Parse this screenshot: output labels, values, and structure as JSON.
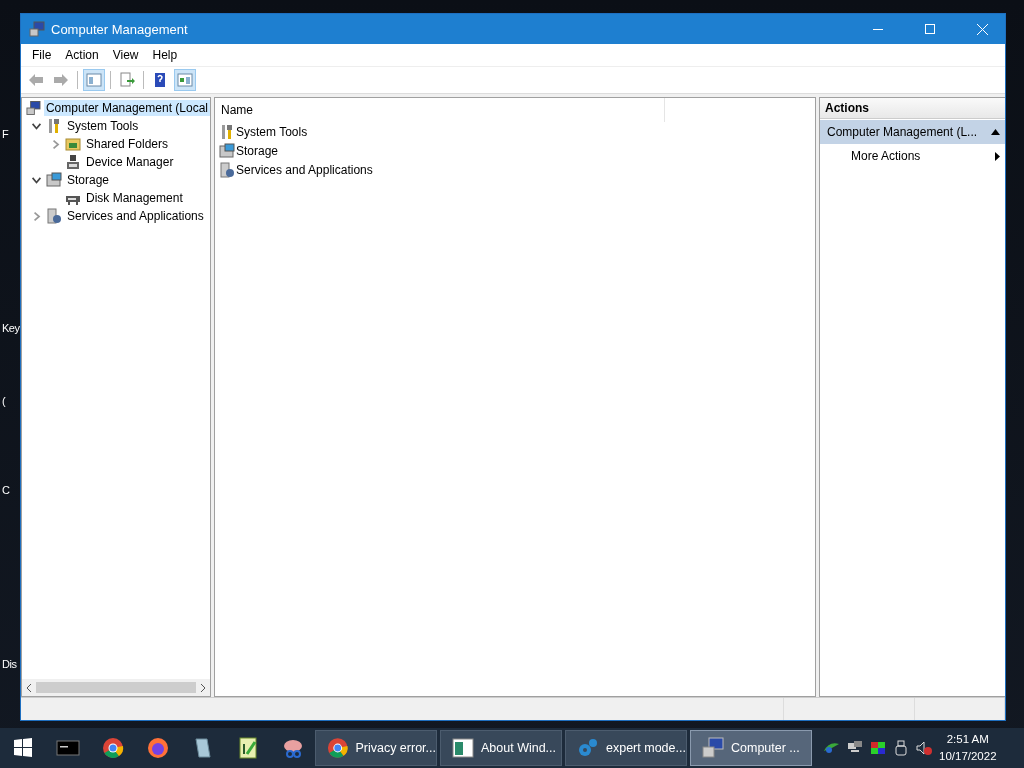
{
  "desktop_labels": [
    "F",
    "Key",
    "(",
    "C",
    "Dis"
  ],
  "window": {
    "title": "Computer Management"
  },
  "menu": [
    "File",
    "Action",
    "View",
    "Help"
  ],
  "toolbar": [
    {
      "kind": "back",
      "disabled": true
    },
    {
      "kind": "forward",
      "disabled": true
    },
    {
      "kind": "sep"
    },
    {
      "kind": "tree",
      "pressed": true
    },
    {
      "kind": "sep"
    },
    {
      "kind": "export",
      "pressed": false
    },
    {
      "kind": "sep"
    },
    {
      "kind": "help",
      "pressed": false
    },
    {
      "kind": "actionpane",
      "pressed": true
    }
  ],
  "tree": [
    {
      "label": "Computer Management (Local",
      "kind": "computer",
      "selected": true,
      "children": [
        {
          "label": "System Tools",
          "kind": "tools",
          "expanded": true,
          "selected": false,
          "children": [
            {
              "label": "Shared Folders",
              "kind": "shared",
              "expanded": false,
              "selected": false
            },
            {
              "label": "Device Manager",
              "kind": "device",
              "selected": false
            }
          ]
        },
        {
          "label": "Storage",
          "kind": "storage",
          "expanded": true,
          "selected": false,
          "children": [
            {
              "label": "Disk Management",
              "kind": "disk",
              "selected": false
            }
          ]
        },
        {
          "label": "Services and Applications",
          "kind": "services",
          "expanded": false,
          "selected": false
        }
      ]
    }
  ],
  "list": {
    "columns": [
      "Name"
    ],
    "rows": [
      {
        "label": "System Tools",
        "kind": "tools"
      },
      {
        "label": "Storage",
        "kind": "storage"
      },
      {
        "label": "Services and Applications",
        "kind": "services"
      }
    ]
  },
  "actions": {
    "title": "Actions",
    "section": {
      "label": "Computer Management (L...",
      "expanded": true
    },
    "items": [
      {
        "label": "More Actions",
        "submenu": true
      }
    ]
  },
  "taskbar": {
    "pinned": [
      {
        "kind": "start"
      },
      {
        "kind": "cmd"
      },
      {
        "kind": "chrome"
      },
      {
        "kind": "firefox"
      },
      {
        "kind": "notepad"
      },
      {
        "kind": "sheet"
      },
      {
        "kind": "snip"
      }
    ],
    "tasks": [
      {
        "label": "Privacy error...",
        "kind": "chrome",
        "selected": false
      },
      {
        "label": "About Wind...",
        "kind": "about",
        "selected": false
      },
      {
        "label": "expert mode...",
        "kind": "gears",
        "selected": false
      },
      {
        "label": "Computer ...",
        "kind": "computer",
        "selected": true
      }
    ],
    "tray": [
      {
        "kind": "network-green"
      },
      {
        "kind": "network"
      },
      {
        "kind": "color"
      },
      {
        "kind": "usb"
      },
      {
        "kind": "mute"
      }
    ],
    "time": "2:51 AM",
    "date": "10/17/2022"
  }
}
